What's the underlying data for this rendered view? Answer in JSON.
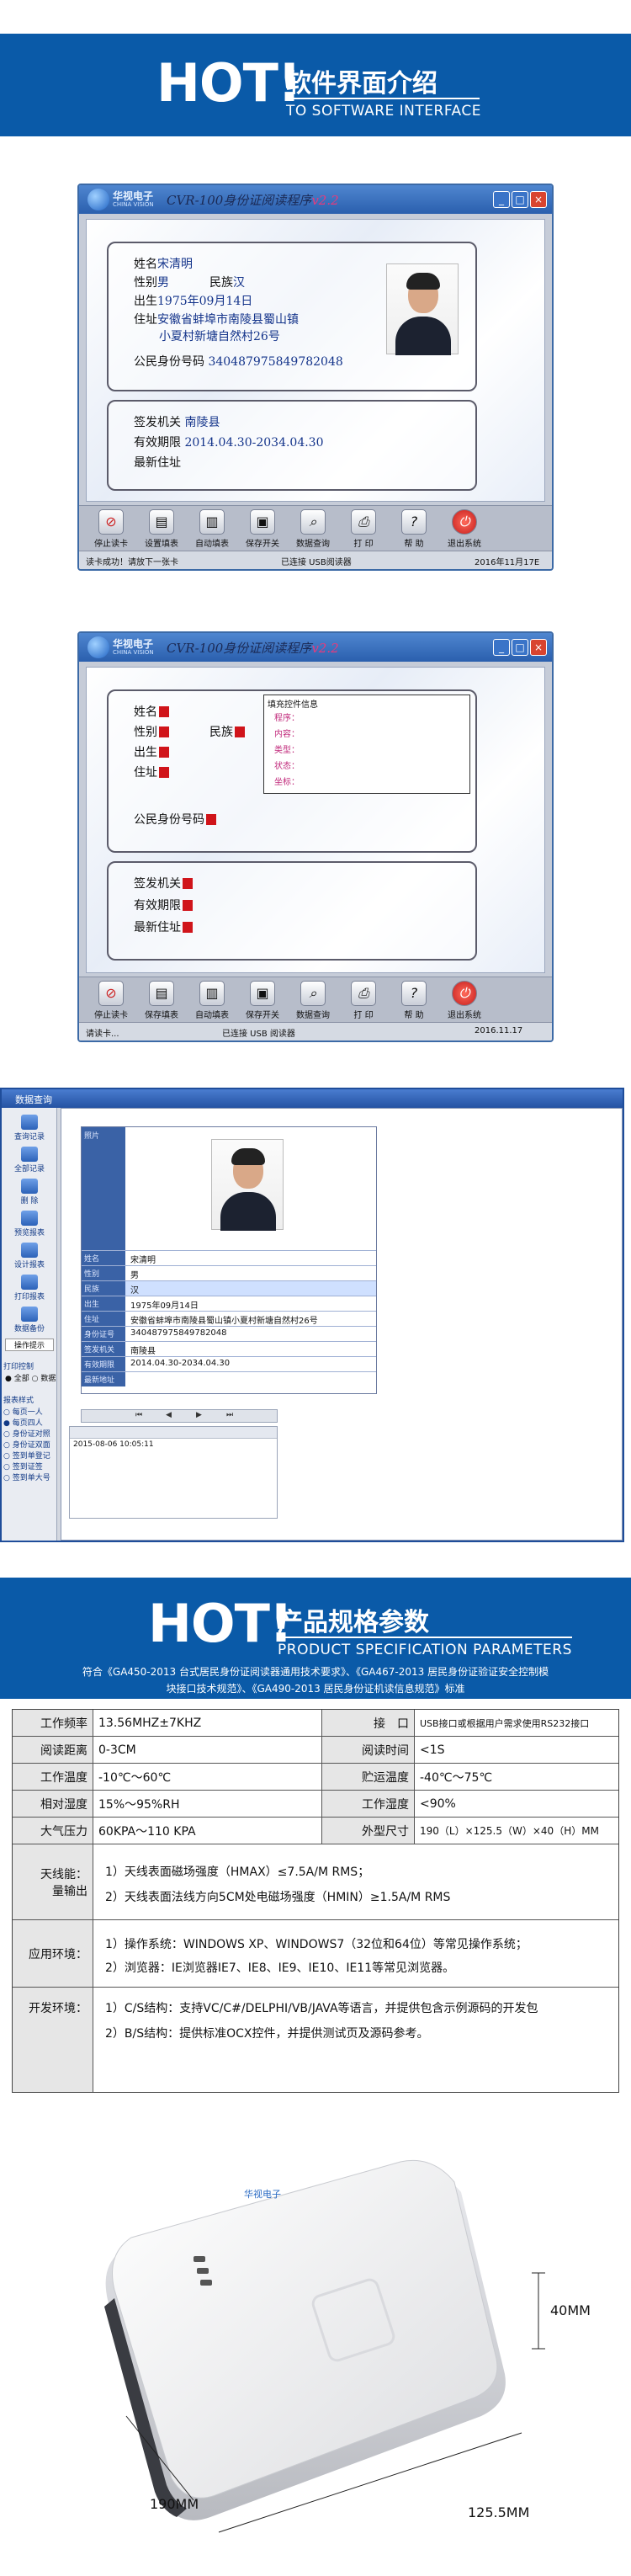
{
  "banner1": {
    "hot": "HOT!",
    "title_cn": "软件界面介绍",
    "title_en": "TO SOFTWARE INTERFACE"
  },
  "win1": {
    "logo_cn": "华视电子",
    "logo_en": "CHINA VISION",
    "title": "CVR-100身份证阅读程序",
    "version": "v2.2",
    "fields": {
      "name_label": "姓名",
      "name": "宋清明",
      "sex_label": "性别",
      "sex": "男",
      "nation_label": "民族",
      "nation": "汉",
      "birth_label": "出生",
      "birth": "1975年09月14日",
      "addr_label": "住址",
      "addr1": "安徽省蚌埠市南陵县蜀山镇",
      "addr2": "小夏村新塘自然村26号",
      "id_label": "公民身份号码",
      "id": "340487975849782048",
      "agency_label": "签发机关",
      "agency": "南陵县",
      "valid_label": "有效期限",
      "valid": "2014.04.30-2034.04.30",
      "latest_label": "最新住址"
    },
    "toolbar": [
      "停止读卡",
      "设置填表",
      "自动填表",
      "保存开关",
      "数据查询",
      "打 印",
      "帮 助",
      "退出系统"
    ],
    "status": [
      "读卡成功！请放下一张卡",
      "已连接 USB阅读器",
      "2016年11月17E"
    ]
  },
  "win2": {
    "logo_cn": "华视电子",
    "logo_en": "CHINA VISION",
    "title": "CVR-100身份证阅读程序",
    "version": "v2.2",
    "labels": [
      "姓名",
      "性别",
      "民族",
      "出生",
      "住址",
      "公民身份号码",
      "签发机关",
      "有效期限",
      "最新住址"
    ],
    "panel_title": "填充控件信息",
    "panel_rows": [
      "程序：",
      "内容：",
      "类型：",
      "状态：",
      "坐标："
    ],
    "toolbar": [
      "停止读卡",
      "保存填表",
      "自动填表",
      "保存开关",
      "数据查询",
      "打 印",
      "帮 助",
      "退出系统"
    ],
    "status": [
      "请读卡...",
      "已连接 USB 阅读器",
      "2016.11.17"
    ]
  },
  "query": {
    "title": "数据查询",
    "side": [
      "查询记录",
      "全部记录",
      "删 除",
      "预览报表",
      "设计报表",
      "打印报表",
      "数据备份",
      "操作提示"
    ],
    "print_label": "打印控制",
    "print_opts": [
      "全部",
      "数据"
    ],
    "report_label": "报表样式",
    "report_opts": [
      "每页一人",
      "每页四人",
      "身份证对照",
      "身份证双面",
      "签到单登记",
      "签到证签",
      "签到单大号"
    ],
    "photo_label": "照片",
    "rows": [
      {
        "k": "姓名",
        "v": "宋清明"
      },
      {
        "k": "性别",
        "v": "男"
      },
      {
        "k": "民族",
        "v": "汉"
      },
      {
        "k": "出生",
        "v": "1975年09月14日"
      },
      {
        "k": "住址",
        "v": "安徽省蚌埠市南陵县蜀山镇小夏村新塘自然村26号"
      },
      {
        "k": "身份证号",
        "v": "340487975849782048"
      },
      {
        "k": "签发机关",
        "v": "南陵县"
      },
      {
        "k": "有效期限",
        "v": "2014.04.30-2034.04.30"
      },
      {
        "k": "最新地址",
        "v": ""
      }
    ],
    "list_time": "2015-08-06 10:05:11"
  },
  "banner2": {
    "hot": "HOT!",
    "title_cn": "产品规格参数",
    "title_en": "PRODUCT SPECIFICATION PARAMETERS",
    "intro1": "符合《GA450-2013 台式居民身份证阅读器通用技术要求》、《GA467-2013 居民身份证验证安全控制模",
    "intro2": "块接口技术规范》、《GA490-2013 居民身份证机读信息规范》标准"
  },
  "spec": {
    "rows": [
      {
        "k1": "工作频率",
        "v1": "13.56MHZ±7KHZ",
        "k2": "接　口",
        "v2": "USB接口或根据用户需求使用RS232接口"
      },
      {
        "k1": "阅读距离",
        "v1": "0-3CM",
        "k2": "阅读时间",
        "v2": "<1S"
      },
      {
        "k1": "工作温度",
        "v1": "-10℃～60℃",
        "k2": "贮运温度",
        "v2": "-40℃～75℃"
      },
      {
        "k1": "相对湿度",
        "v1": "15%～95%RH",
        "k2": "工作湿度",
        "v2": "<90%"
      },
      {
        "k1": "大气压力",
        "v1": "60KPA～110 KPA",
        "k2": "外型尺寸",
        "v2": "190（L）×125.5（W）×40（H）MM"
      }
    ],
    "field_label1": "天线能：",
    "field_label2": "量输出",
    "field1": "1）天线表面磁场强度（HMAX）≤7.5A/M RMS；",
    "field2": "2）天线表面法线方向5CM处电磁场强度（HMIN）≥1.5A/M RMS",
    "env_label": "应用环境：",
    "env1": "1）操作系统：WINDOWS XP、WINDOWS7（32位和64位）等常见操作系统；",
    "env2": "2）浏览器：IE浏览器IE7、IE8、IE9、IE10、IE11等常见浏览器。",
    "dev_label": "开发环境：",
    "dev1": "1）C/S结构：支持VC/C#/DELPHI/VB/JAVA等语言，并提供包含示例源码的开发包",
    "dev2": "2）B/S结构：提供标准OCX控件，并提供测试页及源码参考。"
  },
  "device": {
    "logo": "华视电子",
    "dim_length": "190MM",
    "dim_width": "125.5MM",
    "dim_height": "40MM"
  }
}
